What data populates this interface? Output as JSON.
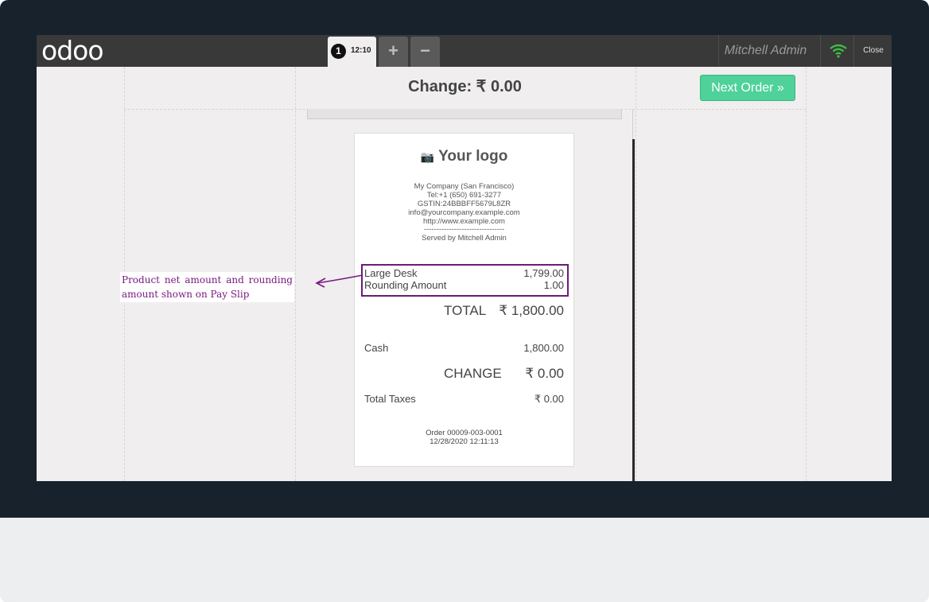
{
  "topbar": {
    "logo": "odoo",
    "order_tab": {
      "number": "1",
      "time": "12:10"
    },
    "add_label": "+",
    "remove_label": "−",
    "user": "Mitchell Admin",
    "close_label": "Close",
    "wifi_color": "#3cbb45"
  },
  "payment": {
    "change_title": "Change: ₹ 0.00",
    "next_order_label": "Next Order »"
  },
  "receipt": {
    "logo_text": "Your logo",
    "logo_icon": "camera-icon",
    "company_lines": [
      "My Company (San Francisco)",
      "Tel:+1 (650) 691-3277",
      "GSTIN:24BBBFF5679L8ZR",
      "info@yourcompany.example.com",
      "http://www.example.com",
      "--------------------------------",
      "Served by Mitchell Admin"
    ],
    "lines": [
      {
        "name": "Large Desk",
        "amount": "1,799.00"
      },
      {
        "name": "Rounding Amount",
        "amount": "1.00"
      }
    ],
    "dash": "--------",
    "total_label": "TOTAL",
    "total_value": "₹ 1,800.00",
    "payment_label": "Cash",
    "payment_value": "1,800.00",
    "change_label": "CHANGE",
    "change_value": "₹ 0.00",
    "taxes_label": "Total Taxes",
    "taxes_value": "₹ 0.00",
    "order_ref": "Order 00009-003-0001",
    "order_date": "12/28/2020 12:11:13"
  },
  "annotation": {
    "text": "Product net amount and rounding amount shown on Pay Slip",
    "color": "#7a1a82"
  }
}
